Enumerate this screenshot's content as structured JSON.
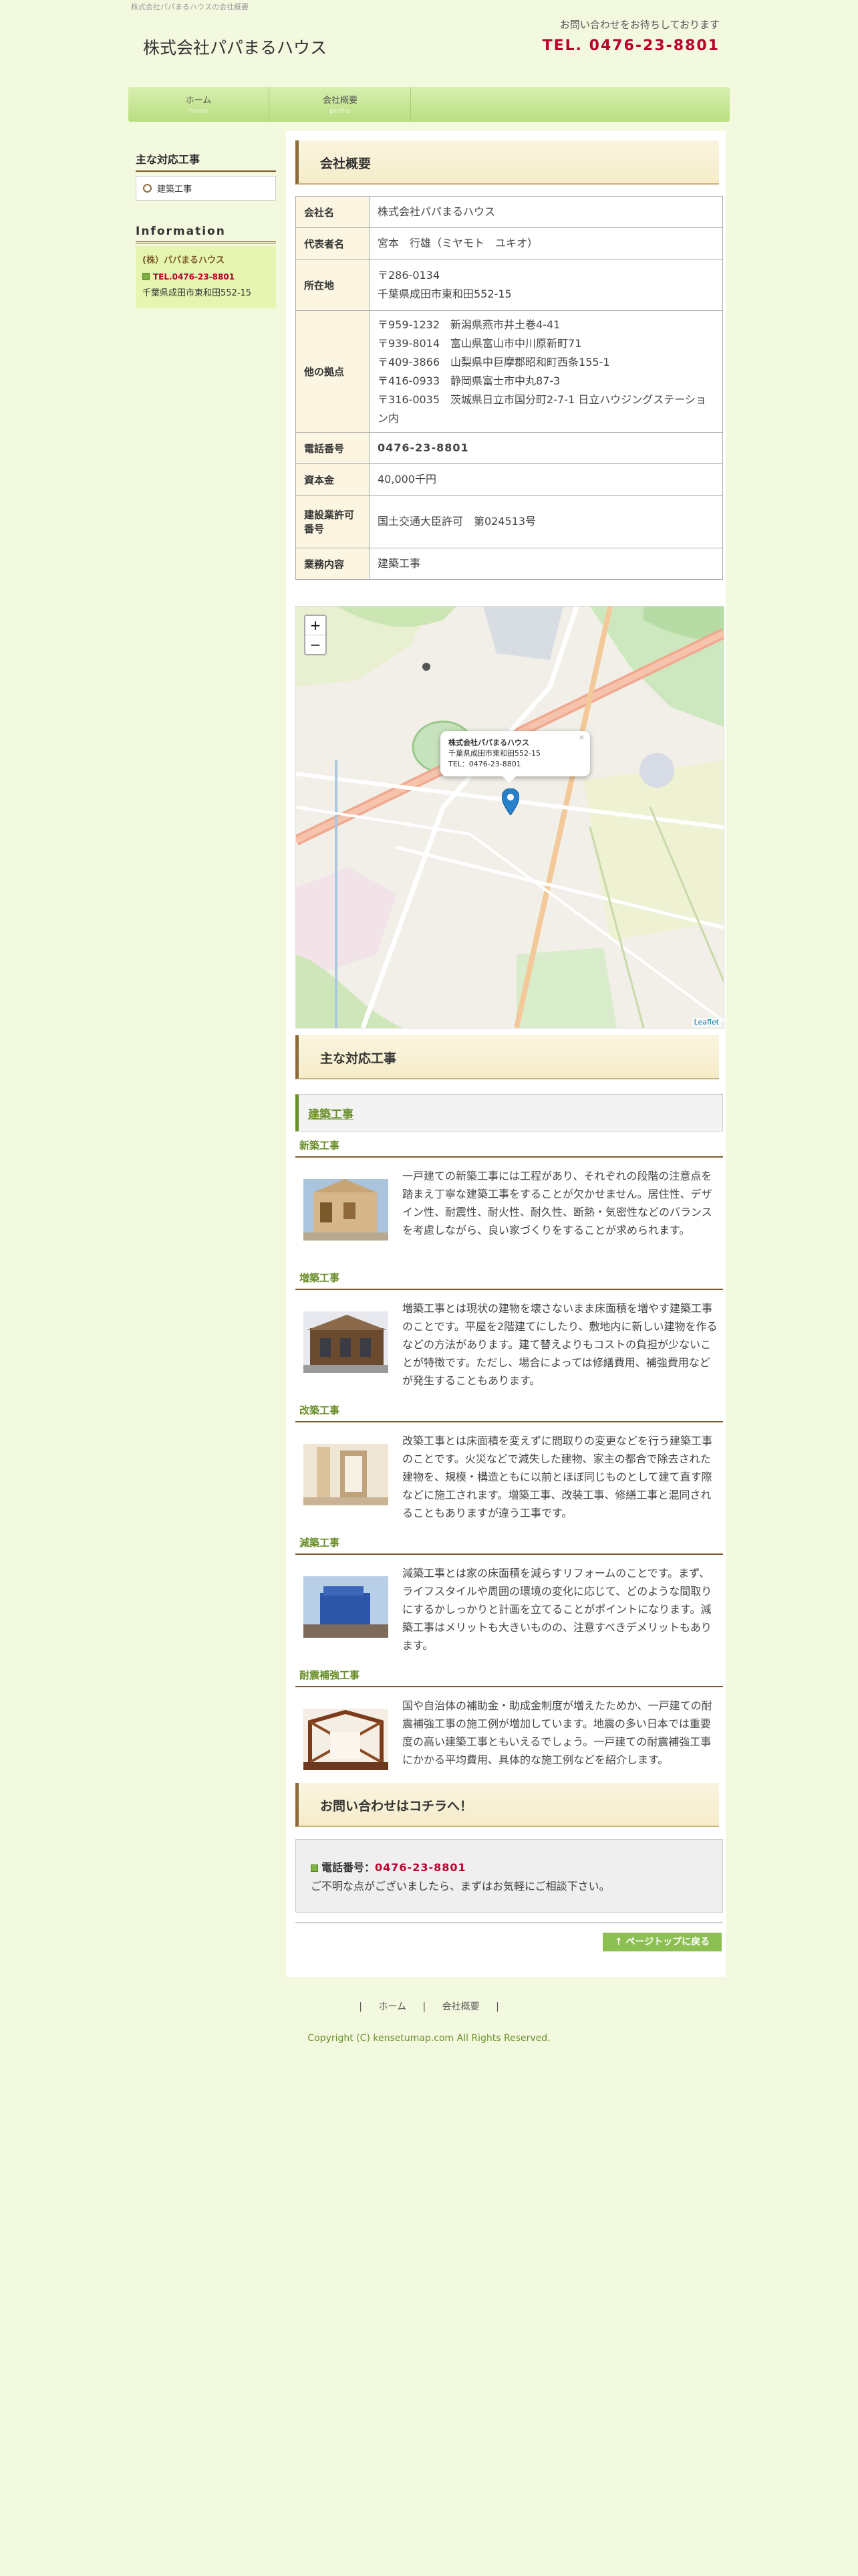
{
  "header": {
    "tagline": "株式会社パパまるハウスの会社概要",
    "site_name": "株式会社パパまるハウス",
    "contact_note": "お問い合わせをお待ちしております",
    "tel": "TEL. 0476-23-8801"
  },
  "nav": {
    "items": [
      {
        "label": "ホーム",
        "sub": "home"
      },
      {
        "label": "会社概要",
        "sub": "profile"
      }
    ]
  },
  "sidebar": {
    "works_title": "主な対応工事",
    "works_items": [
      "建築工事"
    ],
    "info_title": "Information",
    "info_company": "(株）パパまるハウス",
    "info_tel": "TEL.0476-23-8801",
    "info_address": "千葉県成田市東和田552-15"
  },
  "company": {
    "title": "会社概要",
    "rows": [
      {
        "label": "会社名",
        "value": [
          "株式会社パパまるハウス"
        ]
      },
      {
        "label": "代表者名",
        "value": [
          "宮本　行雄（ミヤモト　ユキオ）"
        ]
      },
      {
        "label": "所在地",
        "value": [
          "〒286-0134",
          "千葉県成田市東和田552-15"
        ]
      },
      {
        "label": "他の拠点",
        "value": [
          "〒959-1232　新潟県燕市井土巻4-41",
          "〒939-8014　富山県富山市中川原新町71",
          "〒409-3866　山梨県中巨摩郡昭和町西条155-1",
          "〒416-0933　静岡県富士市中丸87-3",
          "〒316-0035　茨城県日立市国分町2-7-1 日立ハウジングステーション内"
        ]
      },
      {
        "label": "電話番号",
        "value": [
          "0476-23-8801"
        ]
      },
      {
        "label": "資本金",
        "value": [
          "40,000千円"
        ]
      },
      {
        "label": "建設業許可番号",
        "value": [
          "国土交通大臣許可　第024513号"
        ]
      },
      {
        "label": "業務内容",
        "value": [
          "建築工事"
        ]
      }
    ]
  },
  "map": {
    "zoom_in": "+",
    "zoom_out": "−",
    "popup_name": "株式会社パパまるハウス",
    "popup_address": "千葉県成田市東和田552-15",
    "popup_tel": "TEL：0476-23-8801",
    "popup_close": "×",
    "attribution": "Leaflet"
  },
  "works": {
    "title": "主な対応工事",
    "category": "建築工事",
    "items": [
      {
        "title": "新築工事",
        "desc": "一戸建ての新築工事には工程があり、それぞれの段階の注意点を踏まえ丁寧な建築工事をすることが欠かせません。居住性、デザイン性、耐震性、耐火性、耐久性、断熱・気密性などのバランスを考慮しながら、良い家づくりをすることが求められます。"
      },
      {
        "title": "増築工事",
        "desc": "増築工事とは現状の建物を壊さないまま床面積を増やす建築工事のことです。平屋を2階建てにしたり、敷地内に新しい建物を作るなどの方法があります。建て替えよりもコストの負担が少ないことが特徴です。ただし、場合によっては修繕費用、補強費用などが発生することもあります。"
      },
      {
        "title": "改築工事",
        "desc": "改築工事とは床面積を変えずに間取りの変更などを行う建築工事のことです。火災などで減失した建物、家主の都合で除去された建物を、規模・構造ともに以前とほぼ同じものとして建て直す際などに施工されます。増築工事、改装工事、修繕工事と混同されることもありますが違う工事です。"
      },
      {
        "title": "減築工事",
        "desc": "減築工事とは家の床面積を減らすリフォームのことです。まず、ライフスタイルや周囲の環境の変化に応じて、どのような間取りにするかしっかりと計画を立てることがポイントになります。減築工事はメリットも大きいものの、注意すべきデメリットもあります。"
      },
      {
        "title": "耐震補強工事",
        "desc": "国や自治体の補助金・助成金制度が増えたためか、一戸建ての耐震補強工事の施工例が増加しています。地震の多い日本では重要度の高い建築工事ともいえるでしょう。一戸建ての耐震補強工事にかかる平均費用、具体的な施工例などを紹介します。"
      }
    ]
  },
  "contact": {
    "title": "お問い合わせはコチラへ！",
    "tel_label": "電話番号：",
    "tel": "0476-23-8801",
    "note": "ご不明な点がございましたら、まずはお気軽にご相談下さい。"
  },
  "page_top": "↑ ページトップに戻る",
  "footer": {
    "sep": "|",
    "links": [
      "ホーム",
      "会社概要"
    ],
    "copyright": "Copyright (C) kensetumap.com All Rights Reserved."
  },
  "colors": {
    "accent_red": "#b8002c",
    "accent_green": "#6a8f2a",
    "brown": "#7a5a2b",
    "page_bg": "#f3f9df"
  }
}
